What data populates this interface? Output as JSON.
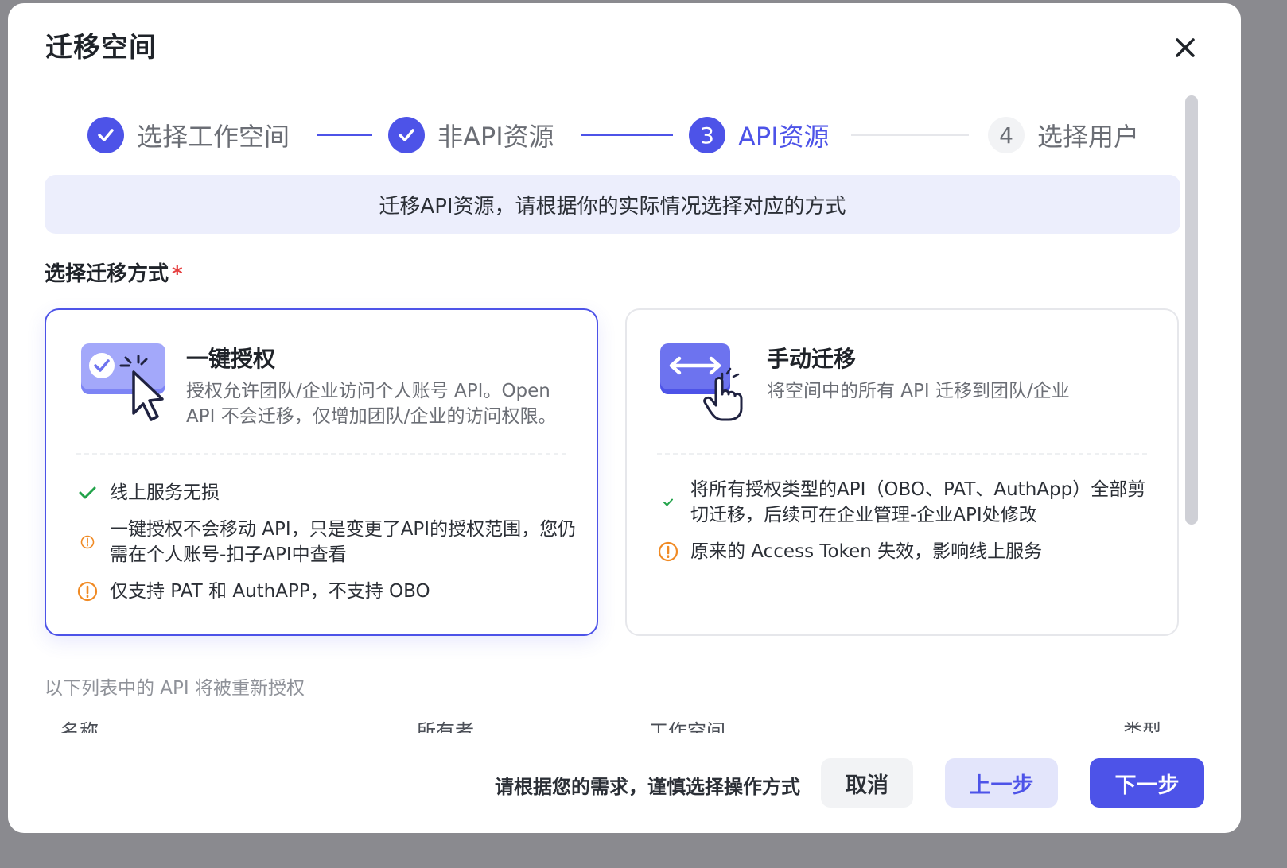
{
  "modal": {
    "title": "迁移空间",
    "close_icon": "close-icon"
  },
  "steps": [
    {
      "label": "选择工作空间",
      "state": "done",
      "number": ""
    },
    {
      "label": "非API资源",
      "state": "done",
      "number": ""
    },
    {
      "label": "API资源",
      "state": "active",
      "number": "3"
    },
    {
      "label": "选择用户",
      "state": "pending",
      "number": "4"
    }
  ],
  "banner": {
    "text": "迁移API资源，请根据你的实际情况选择对应的方式"
  },
  "method": {
    "label": "选择迁移方式",
    "required_mark": "*"
  },
  "cards": {
    "authorize": {
      "title": "一键授权",
      "desc": "授权允许团队/企业访问个人账号 API。Open API 不会迁移，仅增加团队/企业的访问权限。",
      "features": [
        {
          "icon": "check-icon",
          "text": "线上服务无损"
        },
        {
          "icon": "warning-icon",
          "text": "一键授权不会移动 API，只是变更了API的授权范围，您仍需在个人账号-扣子API中查看"
        },
        {
          "icon": "warning-icon",
          "text": "仅支持 PAT 和 AuthAPP，不支持 OBO"
        }
      ]
    },
    "manual": {
      "title": "手动迁移",
      "desc": "将空间中的所有 API 迁移到团队/企业",
      "features": [
        {
          "icon": "check-icon",
          "text": "将所有授权类型的API（OBO、PAT、AuthApp）全部剪切迁移，后续可在企业管理-企业API处修改"
        },
        {
          "icon": "warning-icon",
          "text": "原来的 Access Token 失效，影响线上服务"
        }
      ]
    }
  },
  "list": {
    "caption": "以下列表中的 API 将被重新授权",
    "columns": [
      "名称",
      "所有者",
      "工作空间",
      "类型"
    ]
  },
  "footer": {
    "hint": "请根据您的需求，谨慎选择操作方式",
    "cancel": "取消",
    "prev": "上一步",
    "next": "下一步"
  },
  "colors": {
    "primary": "#4d53e8",
    "success": "#22a34a",
    "warning": "#f08a24"
  }
}
